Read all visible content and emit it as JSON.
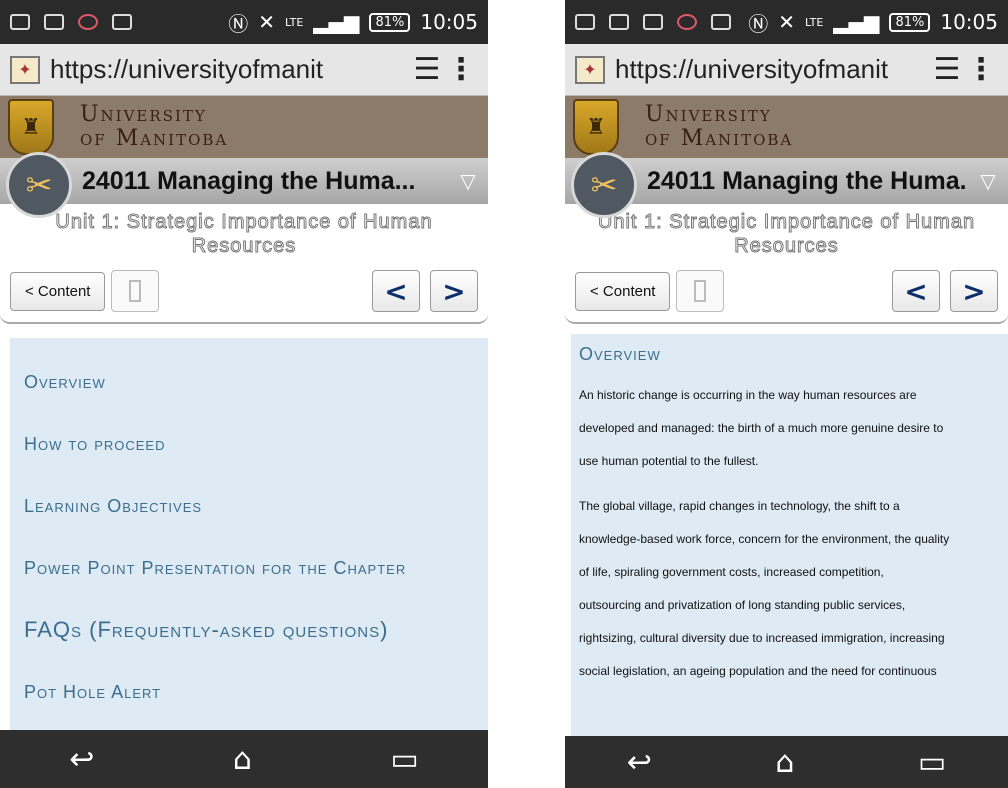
{
  "status": {
    "network": "LTE",
    "battery": "81%",
    "time": "10:05"
  },
  "browser": {
    "url": "https://universityofmanit"
  },
  "banner": {
    "line1": "University",
    "line2": "of Manitoba"
  },
  "course": {
    "title": "24011 Managing the Huma..."
  },
  "unit": {
    "title": "Unit 1: Strategic Importance of Human Resources"
  },
  "nav": {
    "content_label": "< Content",
    "prev": "<",
    "next": ">"
  },
  "menu": {
    "items": [
      {
        "label": "Overview"
      },
      {
        "label": "How to proceed"
      },
      {
        "label": "Learning Objectives"
      },
      {
        "label": "Power Point Presentation for the Chapter"
      },
      {
        "label": "FAQs (Frequently-asked questions)"
      },
      {
        "label": "Pot Hole Alert"
      }
    ]
  },
  "overview": {
    "title": "Overview",
    "para1": [
      "An historic change is occurring in the way human resources are",
      "developed and managed: the birth of a much more genuine desire to",
      "use human potential to the fullest."
    ],
    "para2": [
      "The global village, rapid changes in technology, the shift to a",
      "knowledge-based work force, concern for the environment, the quality",
      "of life, spiraling government costs, increased competition,",
      "outsourcing and privatization of long standing public services,",
      "rightsizing, cultural diversity due to increased immigration, increasing",
      "social legislation, an ageing population and the need for continuous"
    ]
  },
  "bottomnav": {
    "back": "↩",
    "home": "⌂",
    "recent": "▭"
  }
}
